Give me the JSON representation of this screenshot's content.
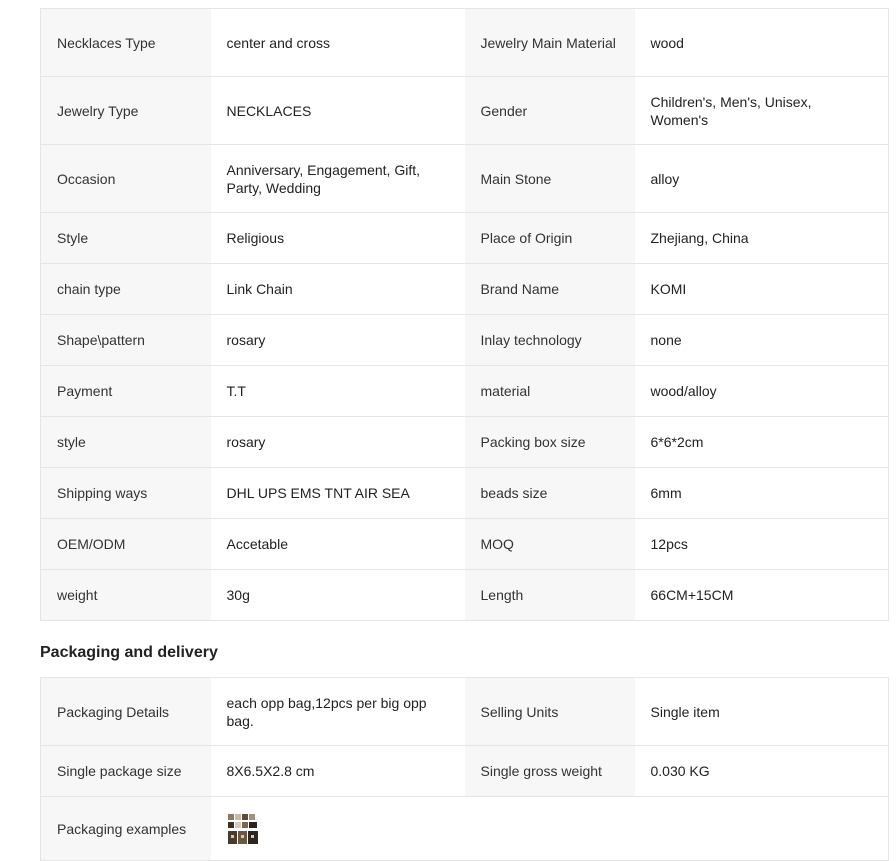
{
  "attributes": [
    [
      {
        "k": "Necklaces Type",
        "v": "center and cross"
      },
      {
        "k": "Jewelry Main Material",
        "v": "wood"
      }
    ],
    [
      {
        "k": "Jewelry Type",
        "v": "NECKLACES"
      },
      {
        "k": "Gender",
        "v": "Children's, Men's, Unisex, Women's"
      }
    ],
    [
      {
        "k": "Occasion",
        "v": "Anniversary, Engagement, Gift, Party, Wedding"
      },
      {
        "k": "Main Stone",
        "v": "alloy"
      }
    ],
    [
      {
        "k": "Style",
        "v": "Religious"
      },
      {
        "k": "Place of Origin",
        "v": "Zhejiang, China"
      }
    ],
    [
      {
        "k": "chain type",
        "v": "Link Chain"
      },
      {
        "k": "Brand Name",
        "v": "KOMI"
      }
    ],
    [
      {
        "k": "Shape\\pattern",
        "v": "rosary"
      },
      {
        "k": "Inlay technology",
        "v": "none"
      }
    ],
    [
      {
        "k": "Payment",
        "v": "T.T"
      },
      {
        "k": "material",
        "v": "wood/alloy"
      }
    ],
    [
      {
        "k": "style",
        "v": "rosary"
      },
      {
        "k": "Packing box size",
        "v": "6*6*2cm"
      }
    ],
    [
      {
        "k": "Shipping ways",
        "v": "DHL UPS EMS TNT AIR SEA"
      },
      {
        "k": "beads size",
        "v": "6mm"
      }
    ],
    [
      {
        "k": "OEM/ODM",
        "v": "Accetable"
      },
      {
        "k": "MOQ",
        "v": "12pcs"
      }
    ],
    [
      {
        "k": "weight",
        "v": "30g"
      },
      {
        "k": "Length",
        "v": "66CM+15CM"
      }
    ]
  ],
  "packaging": {
    "title": "Packaging and delivery",
    "rows": [
      [
        {
          "k": "Packaging Details",
          "v": "each opp bag,12pcs per big opp bag."
        },
        {
          "k": "Selling Units",
          "v": "Single item"
        }
      ],
      [
        {
          "k": "Single package size",
          "v": "8X6.5X2.8 cm"
        },
        {
          "k": "Single gross weight",
          "v": "0.030 KG"
        }
      ]
    ],
    "examples_label": "Packaging examples",
    "examples_icon": "packaging-thumbnail-icon"
  }
}
